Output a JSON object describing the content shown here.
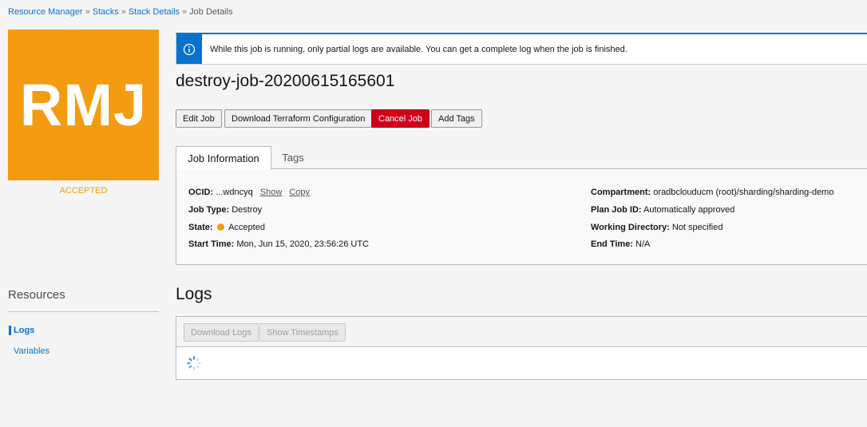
{
  "breadcrumb": {
    "items": [
      "Resource Manager",
      "Stacks",
      "Stack Details"
    ],
    "current": "Job Details",
    "separator": "»"
  },
  "badge": {
    "initials": "RMJ",
    "status": "ACCEPTED",
    "color": "#f39c12"
  },
  "banner": {
    "icon": "info-icon",
    "text": "While this job is running, only partial logs are available. You can get a complete log when the job is finished."
  },
  "job": {
    "title": "destroy-job-20200615165601"
  },
  "actions": {
    "edit": "Edit Job",
    "download_config": "Download Terraform Configuration",
    "cancel": "Cancel Job",
    "add_tags": "Add Tags"
  },
  "tabs": {
    "job_info": "Job Information",
    "tags": "Tags"
  },
  "details": {
    "ocid_label": "OCID:",
    "ocid_value": "...wdncyq",
    "show": "Show",
    "copy": "Copy",
    "job_type_label": "Job Type:",
    "job_type_value": "Destroy",
    "state_label": "State:",
    "state_value": "Accepted",
    "start_time_label": "Start Time:",
    "start_time_value": "Mon, Jun 15, 2020, 23:56:26 UTC",
    "compartment_label": "Compartment:",
    "compartment_value": "oradbclouducm (root)/sharding/sharding-demo",
    "plan_job_label": "Plan Job ID:",
    "plan_job_value": "Automatically approved",
    "working_dir_label": "Working Directory:",
    "working_dir_value": "Not specified",
    "end_time_label": "End Time:",
    "end_time_value": "N/A"
  },
  "resources": {
    "title": "Resources",
    "items": [
      "Logs",
      "Variables"
    ],
    "active": "Logs"
  },
  "logs": {
    "title": "Logs",
    "download": "Download Logs",
    "timestamps": "Show Timestamps"
  }
}
